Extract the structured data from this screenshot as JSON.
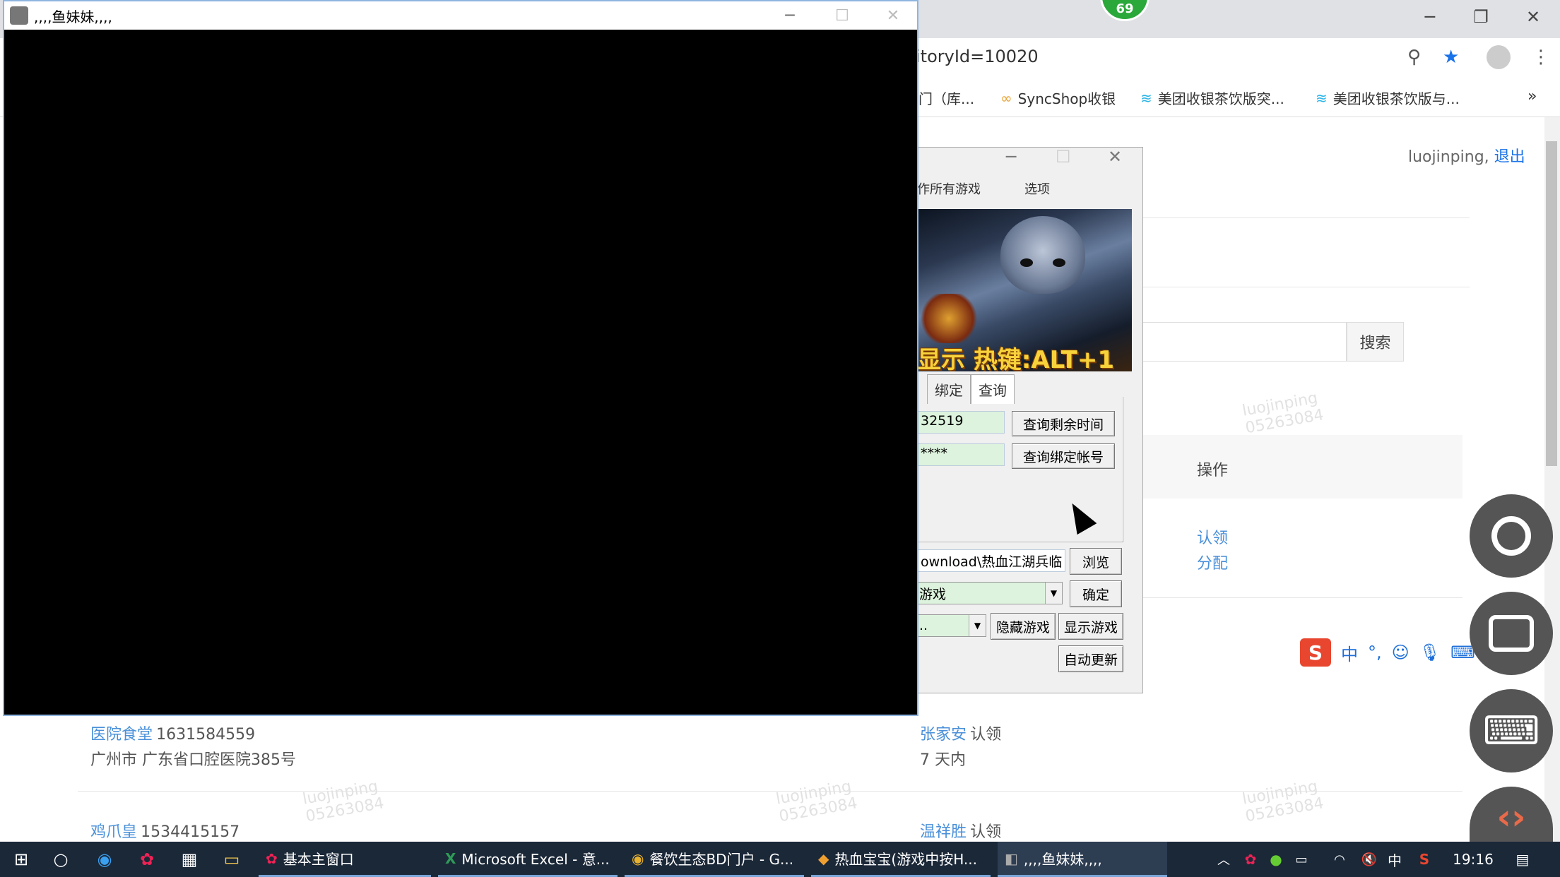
{
  "browser": {
    "badge_count": "69",
    "url_fragment": "itoryId=10020",
    "bookmarks": [
      {
        "label": "门（库...",
        "icon": "folder-icon"
      },
      {
        "label": "SyncShop收银",
        "icon": "sync-icon"
      },
      {
        "label": "美团收银茶饮版突...",
        "icon": "layers-icon"
      },
      {
        "label": "美团收银茶饮版与...",
        "icon": "layers-icon"
      }
    ],
    "more": "»"
  },
  "page": {
    "user": "luojinping,",
    "logout": "退出",
    "search_button": "搜索",
    "col_actions": "操作",
    "action_claim": "认领",
    "action_assign": "分配",
    "rows": [
      {
        "name": "医院食堂",
        "phone": "1631584559",
        "address": "广州市 广东省口腔医院385号",
        "owner": "张家安",
        "status": "认领",
        "days": "7 天内"
      },
      {
        "name": "鸡爪皇",
        "phone": "1534415157",
        "owner": "温祥胜",
        "status": "认领"
      }
    ],
    "watermark_user": "luojinping",
    "watermark_id": "05263084"
  },
  "game_window": {
    "title": ",,,,鱼妹妹,,,,"
  },
  "tool_window": {
    "menu": [
      "作所有游戏",
      "选项"
    ],
    "banner_text": "显示 热键:ALT+1",
    "tabs": [
      "绑定",
      "查询"
    ],
    "field_id": "32519",
    "field_pwd": "****",
    "btn_query_time": "查询剩余时间",
    "btn_query_bind": "查询绑定帐号",
    "path": "ownload\\热血江湖兵临",
    "btn_browse": "浏览",
    "select_game": "游戏",
    "btn_ok": "确定",
    "select_small": "..",
    "btn_hide": "隐藏游戏",
    "btn_show": "显示游戏",
    "btn_update": "自动更新"
  },
  "ime": {
    "logo": "S",
    "mode": "中",
    "punct": "°,"
  },
  "taskbar": {
    "items": [
      {
        "label": "基本主窗口"
      },
      {
        "label": "Microsoft Excel - 意..."
      },
      {
        "label": "餐饮生态BD门户 - G..."
      },
      {
        "label": "热血宝宝(游戏中按H..."
      },
      {
        "label": ",,,,鱼妹妹,,,,"
      }
    ],
    "lang": "中",
    "time": "19:16"
  }
}
